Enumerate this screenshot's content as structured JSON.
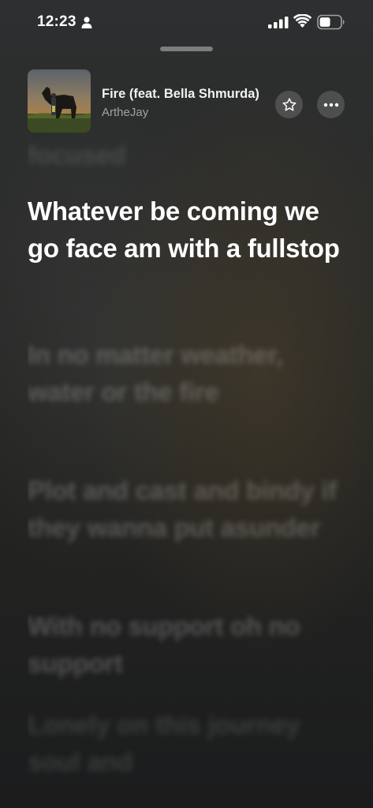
{
  "status_bar": {
    "time": "12:23"
  },
  "now_playing": {
    "title": "Fire (feat. Bella Shmurda)",
    "artist": "ArtheJay"
  },
  "lyrics": {
    "previous": "focused",
    "active": "Whatever be coming we go face am with a fullstop",
    "upcoming": [
      "In no matter weather, water or the fire",
      "Plot and cast and bindy if they wanna put asunder",
      "With no support oh no support",
      "Lonely on this journey soul and"
    ]
  },
  "icons": {
    "status": [
      "person-icon",
      "signal-icon",
      "wifi-icon",
      "battery-icon"
    ],
    "actions": [
      "star-icon",
      "ellipsis-icon"
    ]
  },
  "colors": {
    "text_primary": "#ffffff",
    "text_secondary": "#8c8c8c",
    "background": "#262727"
  }
}
